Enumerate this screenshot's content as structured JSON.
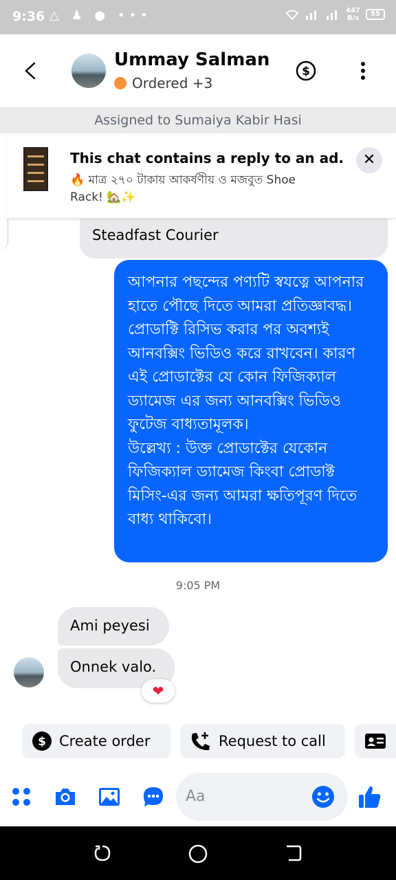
{
  "status_bar": {
    "time": "9:36",
    "icons": "△ ♟ ● •••",
    "net_speed": "447",
    "net_unit": "B/s",
    "battery": "55"
  },
  "header": {
    "contact_name": "Ummay Salman",
    "status_label": "Ordered +3",
    "status_color": "#f7923a"
  },
  "assigned_text": "Assigned to Sumaiya Kabir Hasi",
  "ad_banner": {
    "title": "This chat contains a reply to an ad.",
    "subtitle": "🔥 মাত্র ২৭০ টাকায় আকর্ষণীয় ও মজবুত  Shoe Rack! 🏡✨",
    "close_label": "✕"
  },
  "messages": {
    "partial_incoming": "Steadfast Courier",
    "outgoing_body": "আপনার পছন্দের পণ্যটি স্বযত্নে আপনার হাতে পৌছে দিতে আমরা প্রতিজ্ঞাবদ্ধ। প্রোডাক্টি রিসিভ করার পর অবশ্যই আনবক্সিং ভিডিও করে রাখবেন। কারণ এই প্রোডাক্টের যে কোন ফিজিক্যাল ড্যামেজ এর জন্য আনবক্সিং ভিডিও ফুটেজ বাধ্যতামূলক।\nউল্লেখ্য : উক্ত প্রোডাক্টের যেকোন ফিজিক্যাল ড্যামেজ কিংবা প্রোডাক্ট মিসিং-এর জন্য আমরা ক্ষতিপূরণ দিতে বাধ্য থাকিবো।",
    "timestamp": "9:05 PM",
    "incoming_1": "Ami peyesi",
    "incoming_2": "Onnek valo.",
    "reaction": "❤"
  },
  "quick_actions": {
    "create_order": "Create order",
    "request_call": "Request to call"
  },
  "composer": {
    "placeholder": "Aa"
  },
  "colors": {
    "accent": "#0866ff",
    "bubble_in": "#e9e9eb"
  }
}
